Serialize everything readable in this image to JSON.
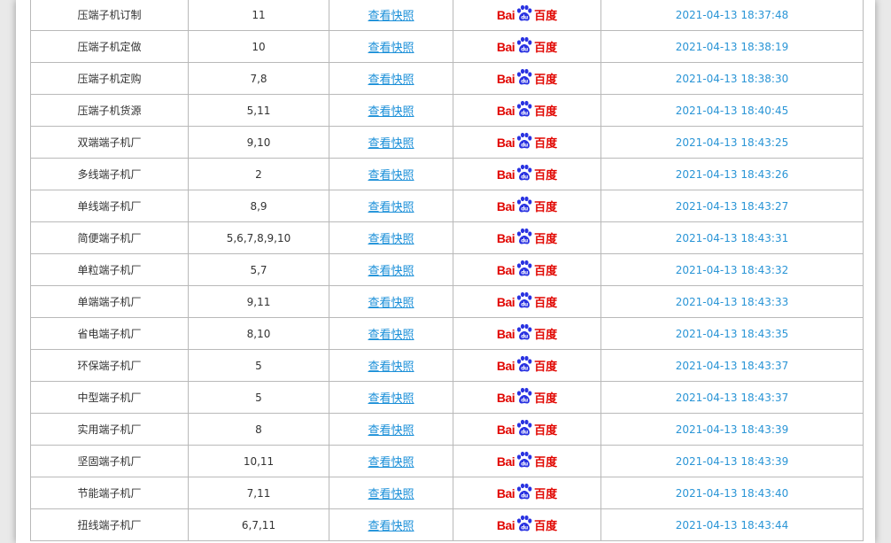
{
  "brand": {
    "engine_logo_text_en": "Bai",
    "engine_logo_text_cn": "百度",
    "engine_color": "#e10601",
    "link_color": "#1a8fd8"
  },
  "rows": [
    {
      "keyword": "压端子机订制",
      "rank": "11",
      "snapshot": "查看快照",
      "engine": "baidu-logo",
      "time": "2021-04-13 18:37:48"
    },
    {
      "keyword": "压端子机定做",
      "rank": "10",
      "snapshot": "查看快照",
      "engine": "baidu-logo",
      "time": "2021-04-13 18:38:19"
    },
    {
      "keyword": "压端子机定购",
      "rank": "7,8",
      "snapshot": "查看快照",
      "engine": "baidu-logo",
      "time": "2021-04-13 18:38:30"
    },
    {
      "keyword": "压端子机货源",
      "rank": "5,11",
      "snapshot": "查看快照",
      "engine": "baidu-logo",
      "time": "2021-04-13 18:40:45"
    },
    {
      "keyword": "双端端子机厂",
      "rank": "9,10",
      "snapshot": "查看快照",
      "engine": "baidu-logo",
      "time": "2021-04-13 18:43:25"
    },
    {
      "keyword": "多线端子机厂",
      "rank": "2",
      "snapshot": "查看快照",
      "engine": "baidu-logo",
      "time": "2021-04-13 18:43:26"
    },
    {
      "keyword": "单线端子机厂",
      "rank": "8,9",
      "snapshot": "查看快照",
      "engine": "baidu-logo",
      "time": "2021-04-13 18:43:27"
    },
    {
      "keyword": "简便端子机厂",
      "rank": "5,6,7,8,9,10",
      "snapshot": "查看快照",
      "engine": "baidu-logo",
      "time": "2021-04-13 18:43:31"
    },
    {
      "keyword": "单粒端子机厂",
      "rank": "5,7",
      "snapshot": "查看快照",
      "engine": "baidu-logo",
      "time": "2021-04-13 18:43:32"
    },
    {
      "keyword": "单端端子机厂",
      "rank": "9,11",
      "snapshot": "查看快照",
      "engine": "baidu-logo",
      "time": "2021-04-13 18:43:33"
    },
    {
      "keyword": "省电端子机厂",
      "rank": "8,10",
      "snapshot": "查看快照",
      "engine": "baidu-logo",
      "time": "2021-04-13 18:43:35"
    },
    {
      "keyword": "环保端子机厂",
      "rank": "5",
      "snapshot": "查看快照",
      "engine": "baidu-logo",
      "time": "2021-04-13 18:43:37"
    },
    {
      "keyword": "中型端子机厂",
      "rank": "5",
      "snapshot": "查看快照",
      "engine": "baidu-logo",
      "time": "2021-04-13 18:43:37"
    },
    {
      "keyword": "实用端子机厂",
      "rank": "8",
      "snapshot": "查看快照",
      "engine": "baidu-logo",
      "time": "2021-04-13 18:43:39"
    },
    {
      "keyword": "坚固端子机厂",
      "rank": "10,11",
      "snapshot": "查看快照",
      "engine": "baidu-logo",
      "time": "2021-04-13 18:43:39"
    },
    {
      "keyword": "节能端子机厂",
      "rank": "7,11",
      "snapshot": "查看快照",
      "engine": "baidu-logo",
      "time": "2021-04-13 18:43:40"
    },
    {
      "keyword": "扭线端子机厂",
      "rank": "6,7,11",
      "snapshot": "查看快照",
      "engine": "baidu-logo",
      "time": "2021-04-13 18:43:44"
    }
  ]
}
